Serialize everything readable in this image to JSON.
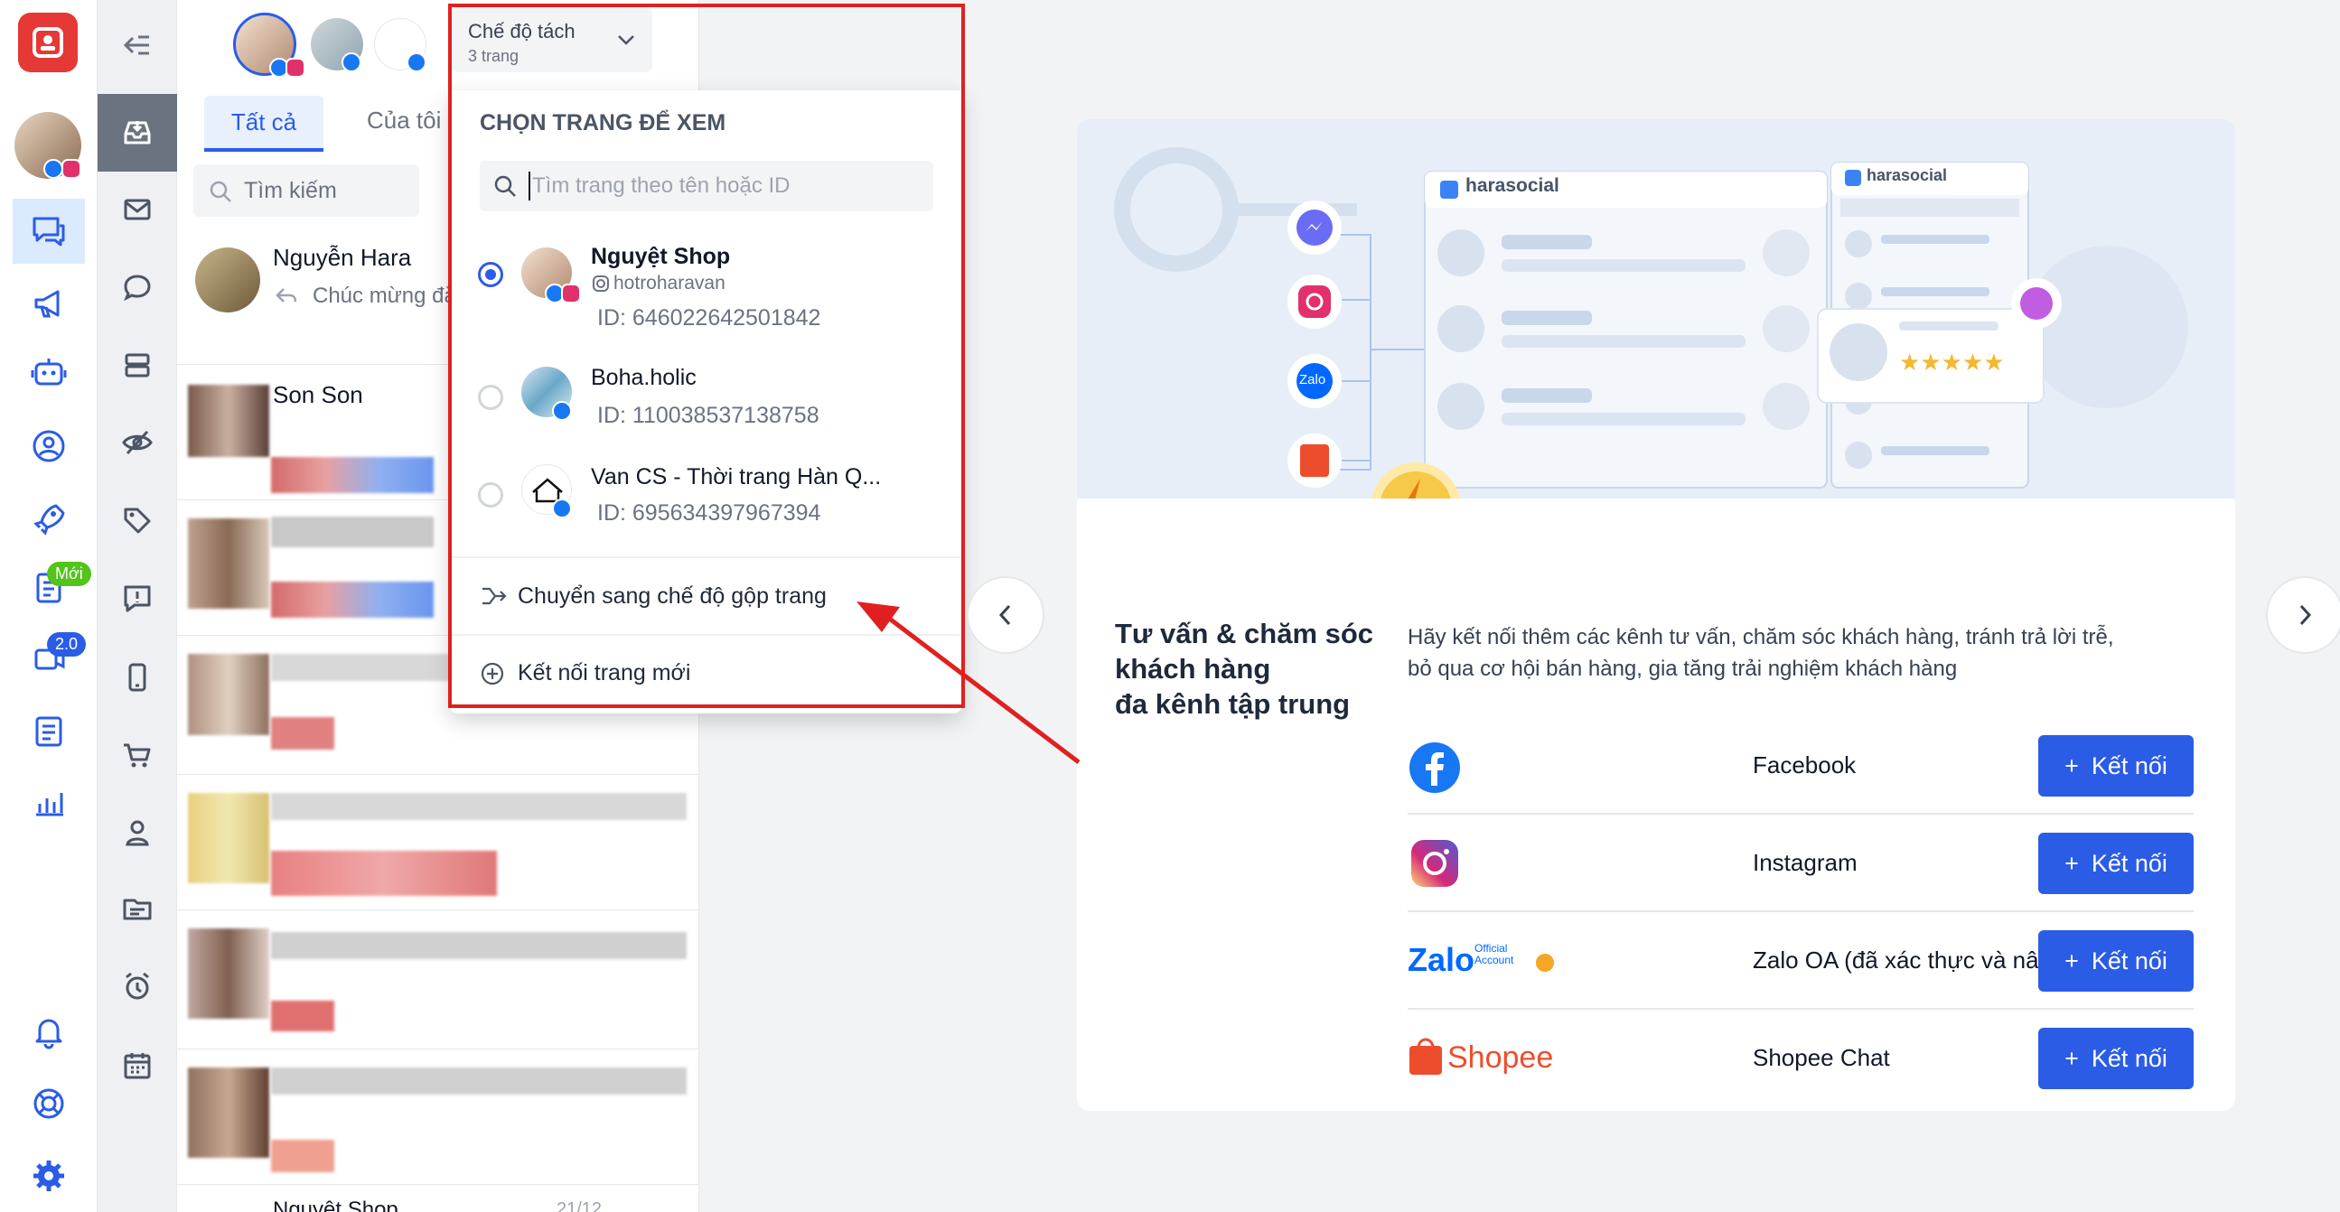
{
  "page_selector": {
    "title": "Chế độ tách",
    "subtitle": "3 trang"
  },
  "tabs": {
    "all": "Tất cả",
    "mine": "Của tôi"
  },
  "conversation_search_placeholder": "Tìm kiếm",
  "conversations": [
    {
      "name": "Nguyễn Hara",
      "preview": "Chúc mừng đặ"
    },
    {
      "name": "Son Son"
    },
    {
      "name": "Nguyệt Shop",
      "time": "21/12"
    }
  ],
  "rail_badges": {
    "new": "Mới",
    "version": "2.0"
  },
  "dropdown": {
    "heading": "CHỌN TRANG ĐỂ XEM",
    "search_placeholder": "Tìm trang theo tên hoặc ID",
    "pages": [
      {
        "name": "Nguyệt Shop",
        "handle": "hotroharavan",
        "id": "ID: 646022642501842",
        "selected": true
      },
      {
        "name": "Boha.holic",
        "id": "ID: 110038537138758",
        "selected": false
      },
      {
        "name": "Van CS - Thời trang Hàn Q...",
        "id": "ID: 695634397967394",
        "selected": false
      }
    ],
    "switch_mode": "Chuyển sang chế độ gộp trang",
    "connect_new": "Kết nối trang mới"
  },
  "promo": {
    "heading": [
      "Tư vấn & chăm sóc",
      "khách hàng",
      "đa kênh tập trung"
    ],
    "description": [
      "Hãy kết nối thêm các kênh tư vấn, chăm sóc khách hàng, tránh trả lời trễ,",
      "bỏ qua cơ hội bán hàng, gia tăng trải nghiệm khách hàng"
    ],
    "brand": "harasocial",
    "channels": [
      {
        "name": "Facebook",
        "button": "Kết nối"
      },
      {
        "name": "Instagram",
        "button": "Kết nối"
      },
      {
        "name": "Zalo OA (đã xác thực và nâng cấp gói)",
        "button": "Kết nối",
        "logo_text": "Zalo",
        "logo_sub": "Official Account"
      },
      {
        "name": "Shopee Chat",
        "button": "Kết nối",
        "logo_text": "Shopee"
      }
    ]
  },
  "colors": {
    "accent": "#2b5ce6",
    "highlight": "#e02020",
    "facebook": "#1877f2",
    "shopee": "#ee4d2d",
    "zalo": "#0068ff"
  }
}
